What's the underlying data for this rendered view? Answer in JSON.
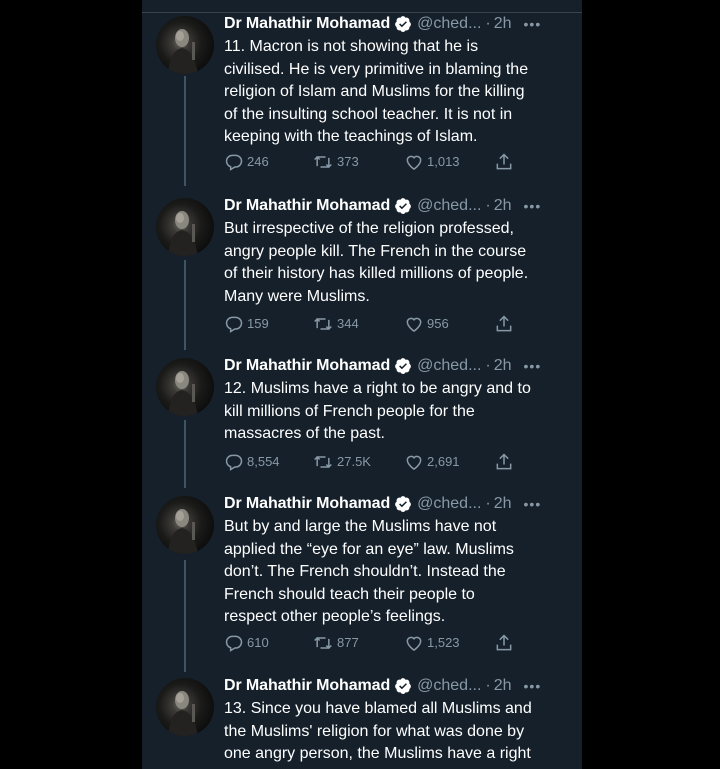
{
  "theme": {
    "background": "#15202b",
    "text": "#ffffff",
    "muted": "#8899a6",
    "verified": "#ffffff",
    "thread_line": "#3d5466"
  },
  "tweets": [
    {
      "author": "Dr Mahathir Mohamad",
      "verified": true,
      "handle": "@ched...",
      "time": "2h",
      "lines": [
        "11. Macron is not showing that he is",
        "civilised. He is very primitive in blaming the",
        "religion of Islam and Muslims for the killing",
        "of the insulting school teacher. It is not in",
        "keeping with the teachings of Islam."
      ],
      "replies": "246",
      "retweets": "373",
      "likes": "1,013"
    },
    {
      "author": "Dr Mahathir Mohamad",
      "verified": true,
      "handle": "@ched...",
      "time": "2h",
      "lines": [
        "But irrespective of the religion professed,",
        "angry people kill. The French in the course",
        "of their history has killed millions of people.",
        "Many were Muslims."
      ],
      "replies": "159",
      "retweets": "344",
      "likes": "956"
    },
    {
      "author": "Dr Mahathir Mohamad",
      "verified": true,
      "handle": "@ched...",
      "time": "2h",
      "lines": [
        "12. Muslims have a right to be angry and to",
        "kill millions of French people for the",
        "massacres of the past."
      ],
      "replies": "8,554",
      "retweets": "27.5K",
      "likes": "2,691"
    },
    {
      "author": "Dr Mahathir Mohamad",
      "verified": true,
      "handle": "@ched...",
      "time": "2h",
      "lines": [
        "But by and large the Muslims have not",
        "applied the “eye for an eye” law. Muslims",
        "don’t. The French shouldn’t. Instead the",
        "French should teach their people to",
        "respect other people’s feelings."
      ],
      "replies": "610",
      "retweets": "877",
      "likes": "1,523"
    },
    {
      "author": "Dr Mahathir Mohamad",
      "verified": true,
      "handle": "@ched...",
      "time": "2h",
      "lines": [
        "13. Since you have blamed all Muslims and",
        "the Muslims' religion for what was done by",
        "one angry person, the Muslims have a right"
      ]
    }
  ]
}
